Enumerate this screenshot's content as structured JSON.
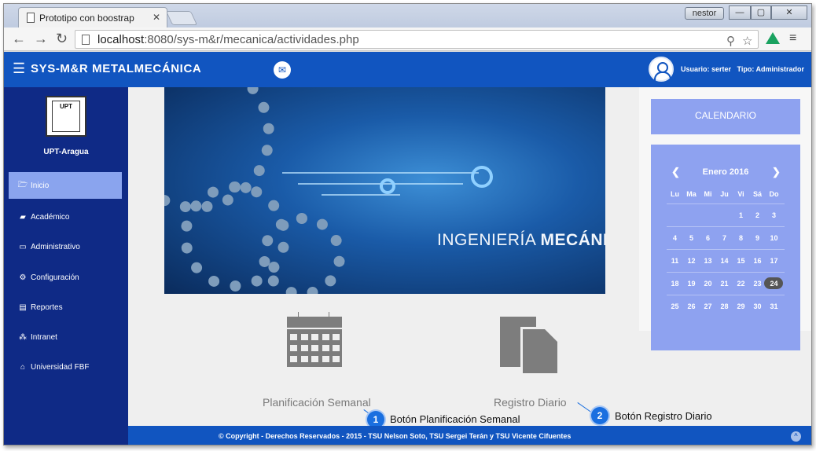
{
  "browser": {
    "tab_title": "Prototipo con boostrap",
    "tab_close": "✕",
    "profile_badge": "nestor",
    "window_controls": {
      "minimize": "—",
      "maximize": "▢",
      "close": "✕"
    },
    "url_host": "localhost",
    "url_rest": ":8080/sys-m&r/mecanica/actividades.php",
    "icons": [
      "back-icon",
      "forward-icon",
      "reload-icon",
      "page-icon",
      "zoom-icon",
      "star-icon",
      "drive-icon",
      "menu-icon"
    ]
  },
  "topbar": {
    "brand": "SYS-M&R  METALMECÁNICA",
    "user_label": "Usuario: serter",
    "role_label": "Tipo: Administrador",
    "icons": [
      "menu-bars-icon",
      "mail-icon",
      "user-avatar-icon"
    ]
  },
  "sidebar": {
    "logo_text": "UPT",
    "org_name": "UPT-Aragua",
    "items": [
      {
        "label": "Inicio",
        "icon": "folder-open-icon",
        "active": true
      },
      {
        "label": "Académico",
        "icon": "book-icon",
        "active": false
      },
      {
        "label": "Administrativo",
        "icon": "monitor-icon",
        "active": false
      },
      {
        "label": "Configuración",
        "icon": "gears-icon",
        "active": false
      },
      {
        "label": "Reportes",
        "icon": "report-icon",
        "active": false
      },
      {
        "label": "Intranet",
        "icon": "sitemap-icon",
        "active": false
      },
      {
        "label": "Universidad FBF",
        "icon": "institution-icon",
        "active": false
      }
    ]
  },
  "main": {
    "banner_caption_light": "INGENIERÍA ",
    "banner_caption_bold": "MECÁNICA",
    "tiles": [
      {
        "label": "Planificación Semanal",
        "icon": "calendar-icon"
      },
      {
        "label": "Registro Diario",
        "icon": "documents-icon"
      }
    ],
    "callouts": [
      {
        "number": "1",
        "label": "Botón Planificación Semanal"
      },
      {
        "number": "2",
        "label": "Botón Registro Diario"
      }
    ]
  },
  "calendar": {
    "header": "CALENDARIO",
    "prev": "❮",
    "next": "❯",
    "month": "Enero 2016",
    "weekdays": [
      "Lu",
      "Ma",
      "Mi",
      "Ju",
      "Vi",
      "Sá",
      "Do"
    ],
    "weeks": [
      [
        "",
        "",
        "",
        "",
        "1",
        "2",
        "3"
      ],
      [
        "4",
        "5",
        "6",
        "7",
        "8",
        "9",
        "10"
      ],
      [
        "11",
        "12",
        "13",
        "14",
        "15",
        "16",
        "17"
      ],
      [
        "18",
        "19",
        "20",
        "21",
        "22",
        "23",
        "24"
      ],
      [
        "25",
        "26",
        "27",
        "28",
        "29",
        "30",
        "31"
      ]
    ],
    "today": "24"
  },
  "footer": {
    "copyright": "© Copyright - Derechos Reservados - 2015 - TSU Nelson Soto, TSU Sergei Terán y TSU Vicente Cifuentes",
    "scroll_top": "^"
  },
  "colors": {
    "brand_blue": "#1155c0",
    "sidebar_navy": "#0f2a86",
    "active_item": "#8aa4ee",
    "calendar_panel": "#8ea2f0",
    "callout_blue": "#1a6fe0"
  }
}
